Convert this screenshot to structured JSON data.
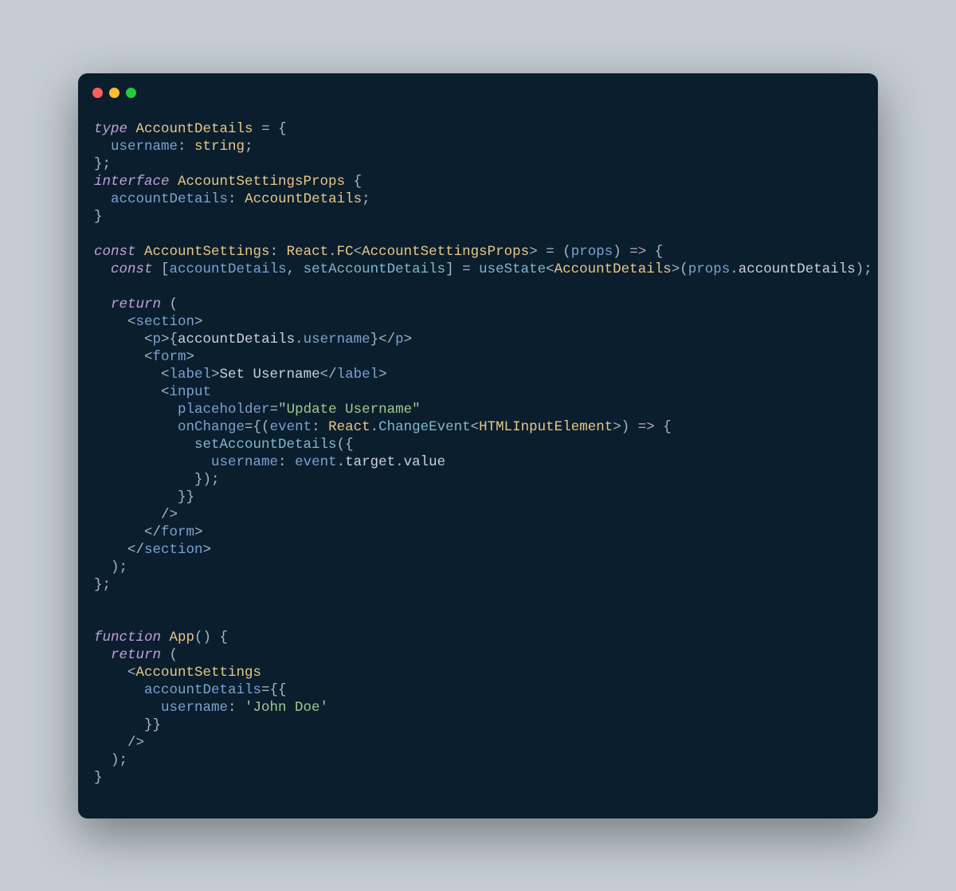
{
  "code": {
    "lines": [
      [
        [
          "kw",
          "type"
        ],
        [
          "punct",
          " "
        ],
        [
          "type",
          "AccountDetails"
        ],
        [
          "punct",
          " = {"
        ]
      ],
      [
        [
          "punct",
          "  "
        ],
        [
          "prop",
          "username"
        ],
        [
          "punct",
          ": "
        ],
        [
          "type",
          "string"
        ],
        [
          "punct",
          ";"
        ]
      ],
      [
        [
          "punct",
          "};"
        ]
      ],
      [
        [
          "kw",
          "interface"
        ],
        [
          "punct",
          " "
        ],
        [
          "type",
          "AccountSettingsProps"
        ],
        [
          "punct",
          " {"
        ]
      ],
      [
        [
          "punct",
          "  "
        ],
        [
          "prop",
          "accountDetails"
        ],
        [
          "punct",
          ": "
        ],
        [
          "type",
          "AccountDetails"
        ],
        [
          "punct",
          ";"
        ]
      ],
      [
        [
          "punct",
          "}"
        ]
      ],
      [
        [
          "punct",
          ""
        ]
      ],
      [
        [
          "kw",
          "const"
        ],
        [
          "punct",
          " "
        ],
        [
          "type",
          "AccountSettings"
        ],
        [
          "punct",
          ": "
        ],
        [
          "type",
          "React"
        ],
        [
          "punct",
          "."
        ],
        [
          "type",
          "FC"
        ],
        [
          "punct",
          "<"
        ],
        [
          "type",
          "AccountSettingsProps"
        ],
        [
          "punct",
          "> = ("
        ],
        [
          "prop",
          "props"
        ],
        [
          "punct",
          ") "
        ],
        [
          "kw",
          "=>"
        ],
        [
          "punct",
          " {"
        ]
      ],
      [
        [
          "punct",
          "  "
        ],
        [
          "kw",
          "const"
        ],
        [
          "punct",
          " ["
        ],
        [
          "prop",
          "accountDetails"
        ],
        [
          "punct",
          ", "
        ],
        [
          "fn",
          "setAccountDetails"
        ],
        [
          "punct",
          "] = "
        ],
        [
          "fn",
          "useState"
        ],
        [
          "punct",
          "<"
        ],
        [
          "type",
          "AccountDetails"
        ],
        [
          "punct",
          ">("
        ],
        [
          "prop",
          "props"
        ],
        [
          "punct",
          "."
        ],
        [
          "var",
          "accountDetails"
        ],
        [
          "punct",
          ");"
        ]
      ],
      [
        [
          "punct",
          ""
        ]
      ],
      [
        [
          "punct",
          "  "
        ],
        [
          "kw",
          "return"
        ],
        [
          "punct",
          " ("
        ]
      ],
      [
        [
          "punct",
          "    <"
        ],
        [
          "tag",
          "section"
        ],
        [
          "punct",
          ">"
        ]
      ],
      [
        [
          "punct",
          "      <"
        ],
        [
          "tag",
          "p"
        ],
        [
          "punct",
          ">{"
        ],
        [
          "var",
          "accountDetails"
        ],
        [
          "punct",
          "."
        ],
        [
          "prop",
          "username"
        ],
        [
          "punct",
          "}</"
        ],
        [
          "tag",
          "p"
        ],
        [
          "punct",
          ">"
        ]
      ],
      [
        [
          "punct",
          "      <"
        ],
        [
          "tag",
          "form"
        ],
        [
          "punct",
          ">"
        ]
      ],
      [
        [
          "punct",
          "        <"
        ],
        [
          "tag",
          "label"
        ],
        [
          "punct",
          ">"
        ],
        [
          "var",
          "Set Username"
        ],
        [
          "punct",
          "</"
        ],
        [
          "tag",
          "label"
        ],
        [
          "punct",
          ">"
        ]
      ],
      [
        [
          "punct",
          "        <"
        ],
        [
          "tag",
          "input"
        ]
      ],
      [
        [
          "punct",
          "          "
        ],
        [
          "attr",
          "placeholder"
        ],
        [
          "punct",
          "="
        ],
        [
          "str",
          "\"Update Username\""
        ]
      ],
      [
        [
          "punct",
          "          "
        ],
        [
          "attr",
          "onChange"
        ],
        [
          "punct",
          "={("
        ],
        [
          "prop",
          "event"
        ],
        [
          "punct",
          ": "
        ],
        [
          "type",
          "React"
        ],
        [
          "punct",
          "."
        ],
        [
          "fn",
          "ChangeEvent"
        ],
        [
          "punct",
          "<"
        ],
        [
          "type",
          "HTMLInputElement"
        ],
        [
          "punct",
          ">) "
        ],
        [
          "kw",
          "=>"
        ],
        [
          "punct",
          " {"
        ]
      ],
      [
        [
          "punct",
          "            "
        ],
        [
          "fn",
          "setAccountDetails"
        ],
        [
          "punct",
          "({"
        ]
      ],
      [
        [
          "punct",
          "              "
        ],
        [
          "prop",
          "username"
        ],
        [
          "punct",
          ": "
        ],
        [
          "prop",
          "event"
        ],
        [
          "punct",
          "."
        ],
        [
          "var",
          "target"
        ],
        [
          "punct",
          "."
        ],
        [
          "var",
          "value"
        ]
      ],
      [
        [
          "punct",
          "            });"
        ]
      ],
      [
        [
          "punct",
          "          }}"
        ]
      ],
      [
        [
          "punct",
          "        />"
        ]
      ],
      [
        [
          "punct",
          "      </"
        ],
        [
          "tag",
          "form"
        ],
        [
          "punct",
          ">"
        ]
      ],
      [
        [
          "punct",
          "    </"
        ],
        [
          "tag",
          "section"
        ],
        [
          "punct",
          ">"
        ]
      ],
      [
        [
          "punct",
          "  );"
        ]
      ],
      [
        [
          "punct",
          "};"
        ]
      ],
      [
        [
          "punct",
          ""
        ]
      ],
      [
        [
          "punct",
          ""
        ]
      ],
      [
        [
          "kw",
          "function"
        ],
        [
          "punct",
          " "
        ],
        [
          "type",
          "App"
        ],
        [
          "punct",
          "() {"
        ]
      ],
      [
        [
          "punct",
          "  "
        ],
        [
          "kw",
          "return"
        ],
        [
          "punct",
          " ("
        ]
      ],
      [
        [
          "punct",
          "    <"
        ],
        [
          "type",
          "AccountSettings"
        ]
      ],
      [
        [
          "punct",
          "      "
        ],
        [
          "attr",
          "accountDetails"
        ],
        [
          "punct",
          "={{"
        ]
      ],
      [
        [
          "punct",
          "        "
        ],
        [
          "prop",
          "username"
        ],
        [
          "punct",
          ": "
        ],
        [
          "str",
          "'John Doe'"
        ]
      ],
      [
        [
          "punct",
          "      }}"
        ]
      ],
      [
        [
          "punct",
          "    />"
        ]
      ],
      [
        [
          "punct",
          "  );"
        ]
      ],
      [
        [
          "punct",
          "}"
        ]
      ]
    ]
  }
}
